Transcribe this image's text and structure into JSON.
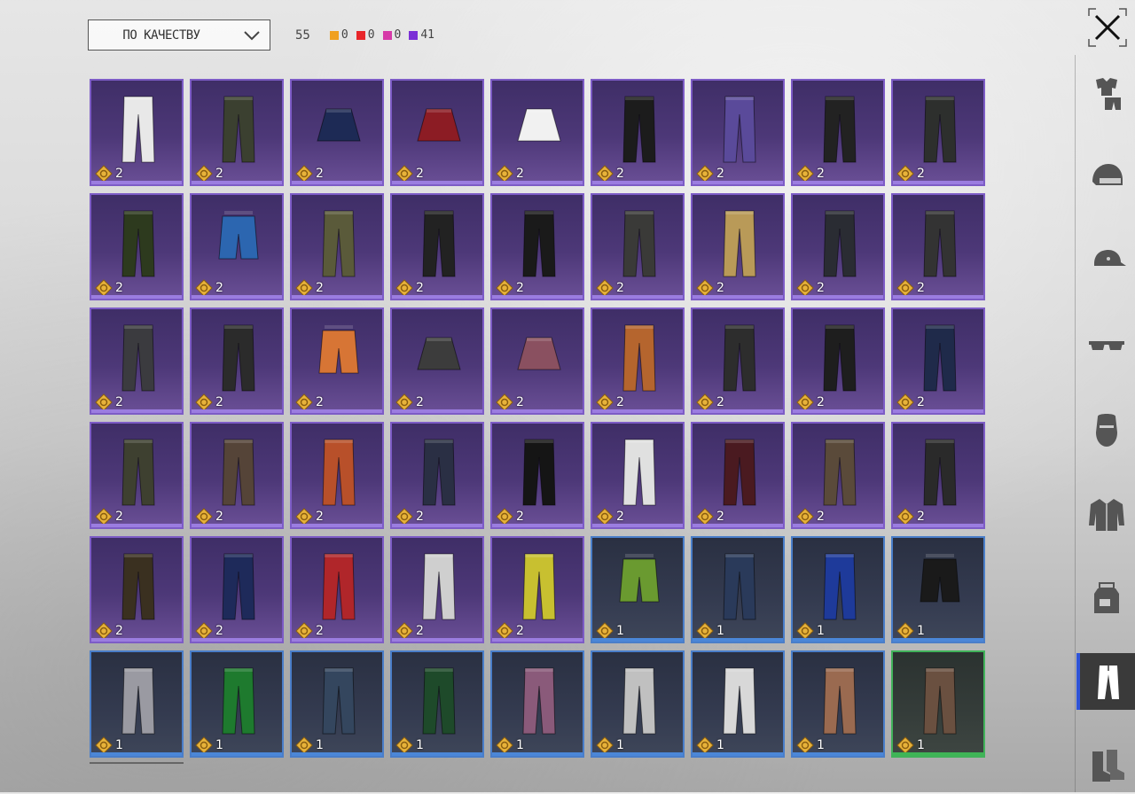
{
  "toolbar": {
    "sort_label": "ПО КАЧЕСТВУ",
    "total": "55",
    "counts": [
      {
        "color": "#f0a020",
        "value": "0"
      },
      {
        "color": "#e8262a",
        "value": "0"
      },
      {
        "color": "#d63aa8",
        "value": "0"
      },
      {
        "color": "#7b2fd6",
        "value": "41"
      }
    ]
  },
  "colors": {
    "epic": "#7d5cc6",
    "rare": "#4a7ec9",
    "uncommon": "#41b25a",
    "badge": "#e7b23a"
  },
  "items": [
    {
      "qty": "2",
      "rarity": "epic",
      "color": "#e8e8e8"
    },
    {
      "qty": "2",
      "rarity": "epic",
      "color": "#3b4030"
    },
    {
      "qty": "2",
      "rarity": "epic",
      "color": "#1d2a55",
      "shape": "skirt"
    },
    {
      "qty": "2",
      "rarity": "epic",
      "color": "#8c1c24",
      "shape": "skirt"
    },
    {
      "qty": "2",
      "rarity": "epic",
      "color": "#f1f1f1",
      "shape": "skirt"
    },
    {
      "qty": "2",
      "rarity": "epic",
      "color": "#1c1c1c"
    },
    {
      "qty": "2",
      "rarity": "epic",
      "color": "#5a4a9a"
    },
    {
      "qty": "2",
      "rarity": "epic",
      "color": "#222222"
    },
    {
      "qty": "2",
      "rarity": "epic",
      "color": "#2d2f2d"
    },
    {
      "qty": "2",
      "rarity": "epic",
      "color": "#2d3a1e"
    },
    {
      "qty": "2",
      "rarity": "epic",
      "color": "#2c66b0",
      "shape": "shorts"
    },
    {
      "qty": "2",
      "rarity": "epic",
      "color": "#5a5a3a"
    },
    {
      "qty": "2",
      "rarity": "epic",
      "color": "#222222"
    },
    {
      "qty": "2",
      "rarity": "epic",
      "color": "#1a1a1a"
    },
    {
      "qty": "2",
      "rarity": "epic",
      "color": "#3a3a38"
    },
    {
      "qty": "2",
      "rarity": "epic",
      "color": "#b99a58"
    },
    {
      "qty": "2",
      "rarity": "epic",
      "color": "#2a2c33"
    },
    {
      "qty": "2",
      "rarity": "epic",
      "color": "#333333"
    },
    {
      "qty": "2",
      "rarity": "epic",
      "color": "#3b3b3f"
    },
    {
      "qty": "2",
      "rarity": "epic",
      "color": "#2b2b2b"
    },
    {
      "qty": "2",
      "rarity": "epic",
      "color": "#d77535",
      "shape": "shorts"
    },
    {
      "qty": "2",
      "rarity": "epic",
      "color": "#3c3c3c",
      "shape": "skirt"
    },
    {
      "qty": "2",
      "rarity": "epic",
      "color": "#8a5060",
      "shape": "skirt"
    },
    {
      "qty": "2",
      "rarity": "epic",
      "color": "#b5652e"
    },
    {
      "qty": "2",
      "rarity": "epic",
      "color": "#2d2d2d"
    },
    {
      "qty": "2",
      "rarity": "epic",
      "color": "#1e1e1e"
    },
    {
      "qty": "2",
      "rarity": "epic",
      "color": "#1f2a4a"
    },
    {
      "qty": "2",
      "rarity": "epic",
      "color": "#3e4030"
    },
    {
      "qty": "2",
      "rarity": "epic",
      "color": "#554438"
    },
    {
      "qty": "2",
      "rarity": "epic",
      "color": "#b8502a"
    },
    {
      "qty": "2",
      "rarity": "epic",
      "color": "#2a2f44"
    },
    {
      "qty": "2",
      "rarity": "epic",
      "color": "#151515"
    },
    {
      "qty": "2",
      "rarity": "epic",
      "color": "#e0e0e0"
    },
    {
      "qty": "2",
      "rarity": "epic",
      "color": "#4a1a20"
    },
    {
      "qty": "2",
      "rarity": "epic",
      "color": "#5a4a3a"
    },
    {
      "qty": "2",
      "rarity": "epic",
      "color": "#2a2a2a"
    },
    {
      "qty": "2",
      "rarity": "epic",
      "color": "#3a3020"
    },
    {
      "qty": "2",
      "rarity": "epic",
      "color": "#1e2a5a"
    },
    {
      "qty": "2",
      "rarity": "epic",
      "color": "#b0262a"
    },
    {
      "qty": "2",
      "rarity": "epic",
      "color": "#cfcfcf"
    },
    {
      "qty": "2",
      "rarity": "epic",
      "color": "#c8c030"
    },
    {
      "qty": "1",
      "rarity": "rare",
      "color": "#6a9a30",
      "shape": "shorts"
    },
    {
      "qty": "1",
      "rarity": "rare",
      "color": "#2a3a5a"
    },
    {
      "qty": "1",
      "rarity": "rare",
      "color": "#1e3a9a"
    },
    {
      "qty": "1",
      "rarity": "rare",
      "color": "#1a1a1a",
      "shape": "shorts"
    },
    {
      "qty": "1",
      "rarity": "rare",
      "color": "#9a9aa2"
    },
    {
      "qty": "1",
      "rarity": "rare",
      "color": "#1e7a2e"
    },
    {
      "qty": "1",
      "rarity": "rare",
      "color": "#34465e"
    },
    {
      "qty": "1",
      "rarity": "rare",
      "color": "#1e4a2a"
    },
    {
      "qty": "1",
      "rarity": "rare",
      "color": "#8a5a7a"
    },
    {
      "qty": "1",
      "rarity": "rare",
      "color": "#c0c0c0"
    },
    {
      "qty": "1",
      "rarity": "rare",
      "color": "#d8d8d8"
    },
    {
      "qty": "1",
      "rarity": "rare",
      "color": "#9a6a50"
    },
    {
      "qty": "1",
      "rarity": "uncommon",
      "color": "#6a5040"
    }
  ],
  "sidebar": [
    {
      "icon": "outfit-icon",
      "active": false
    },
    {
      "icon": "helmet-icon",
      "active": false
    },
    {
      "icon": "cap-icon",
      "active": false
    },
    {
      "icon": "glasses-icon",
      "active": false
    },
    {
      "icon": "mask-icon",
      "active": false
    },
    {
      "icon": "jacket-icon",
      "active": false
    },
    {
      "icon": "backpack-icon",
      "active": false
    },
    {
      "icon": "pants-icon",
      "active": true
    },
    {
      "icon": "boots-icon",
      "active": false
    }
  ]
}
